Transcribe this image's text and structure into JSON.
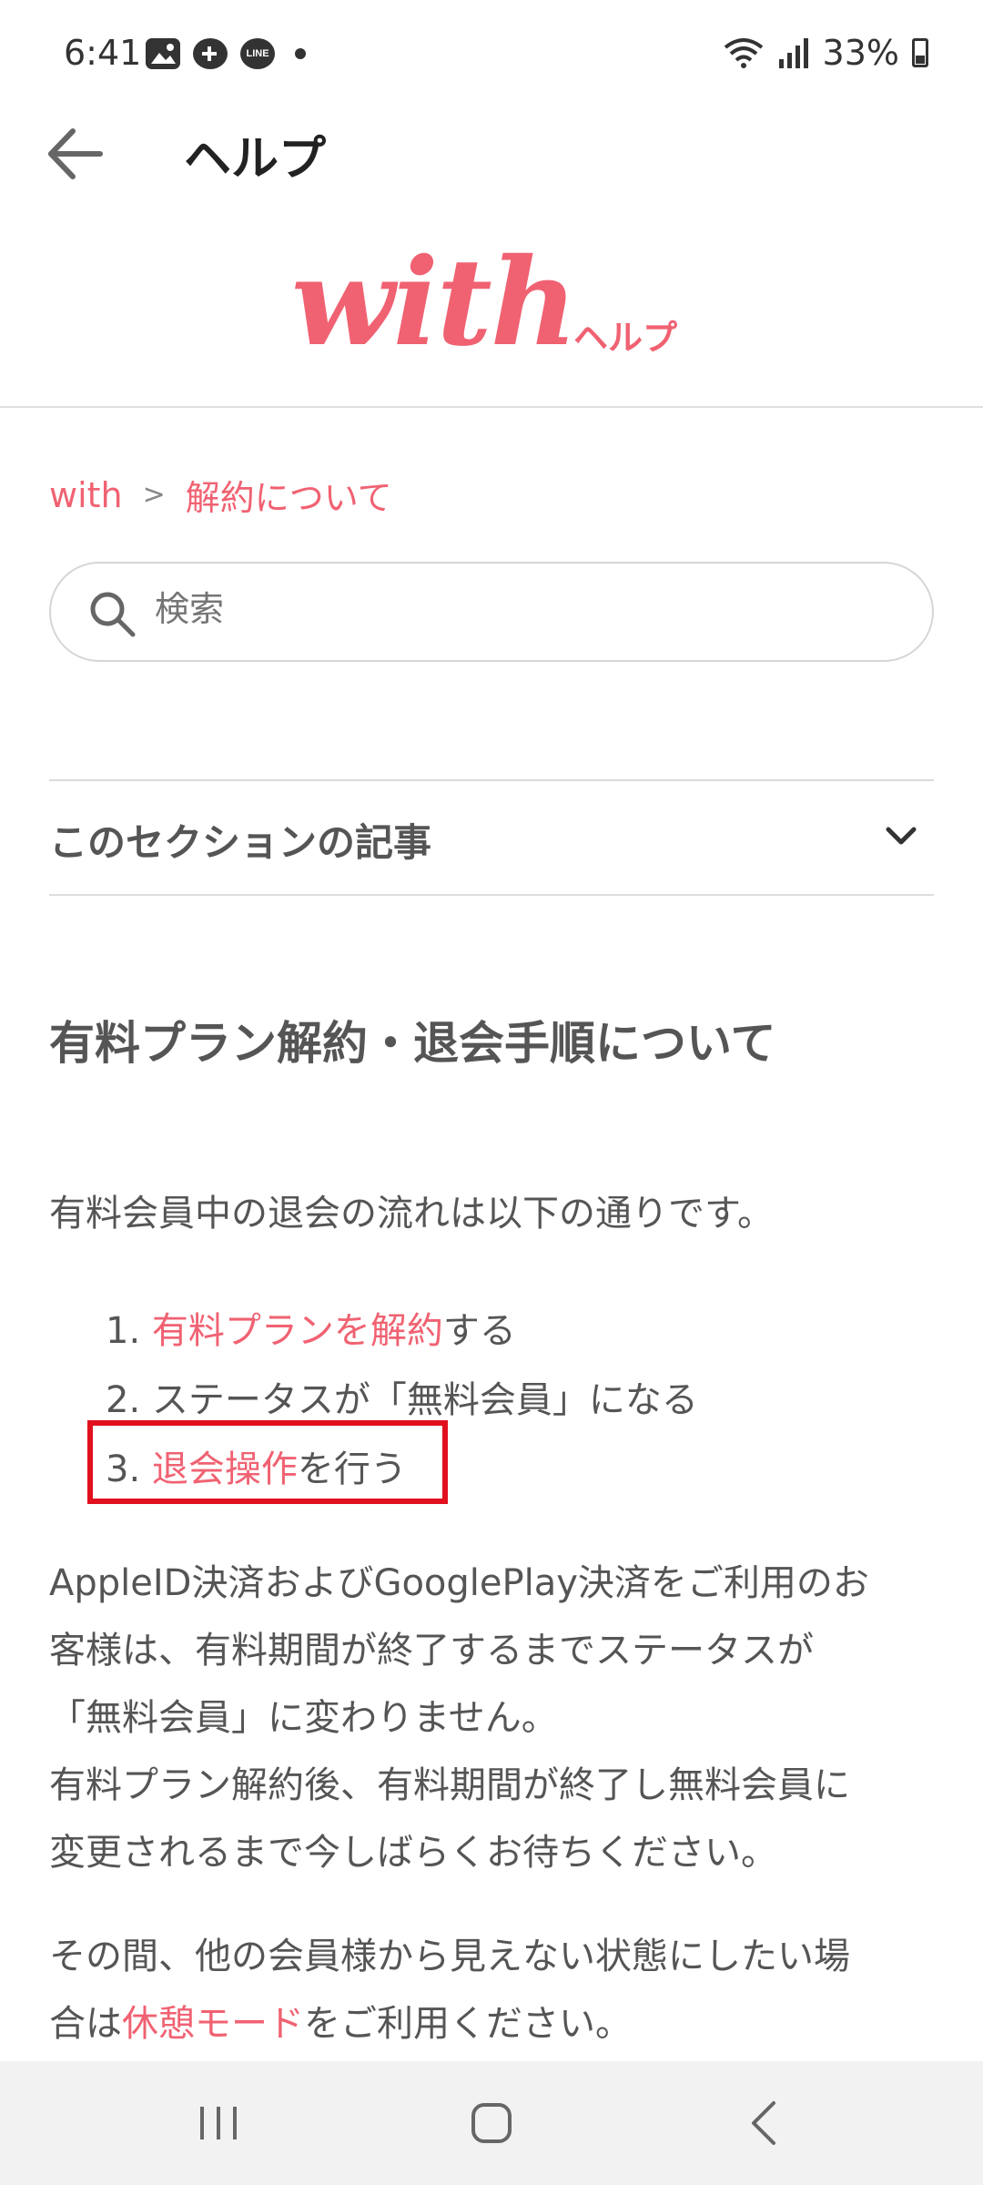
{
  "status_bar": {
    "time": "6:41",
    "battery": "33%",
    "line_label": "LINE"
  },
  "app_bar": {
    "title": "ヘルプ"
  },
  "logo": {
    "brand": "with",
    "help": "ヘルプ",
    "color": "#f06272"
  },
  "breadcrumb": {
    "items": [
      "with",
      "解約について"
    ],
    "separator": ">"
  },
  "search": {
    "placeholder": "検索"
  },
  "section": {
    "title": "このセクションの記事"
  },
  "article": {
    "title": "有料プラン解約・退会手順について",
    "intro": "有料会員中の退会の流れは以下の通りです。",
    "steps": [
      {
        "number": "1.",
        "link": "有料プランを解約",
        "rest": "する"
      },
      {
        "number": "2.",
        "link": "",
        "rest": "ステータスが「無料会員」になる"
      },
      {
        "number": "3.",
        "link": "退会操作",
        "rest": "を行う"
      }
    ],
    "paragraph1_lines": [
      "AppleID決済およびGooglePlay決済をご利用のお",
      "客様は、有料期間が終了するまでステータスが",
      "「無料会員」に変わりません。",
      "有料プラン解約後、有料期間が終了し無料会員に",
      "変更されるまで今しばらくお待ちください。"
    ],
    "paragraph2_line1": "その間、他の会員様から見えない状態にしたい場",
    "paragraph2_line2_prefix": "合は",
    "paragraph2_link": "休憩モード",
    "paragraph2_line2_suffix": "をご利用ください。"
  },
  "colors": {
    "accent": "#f06272",
    "highlight": "#e0101f"
  }
}
